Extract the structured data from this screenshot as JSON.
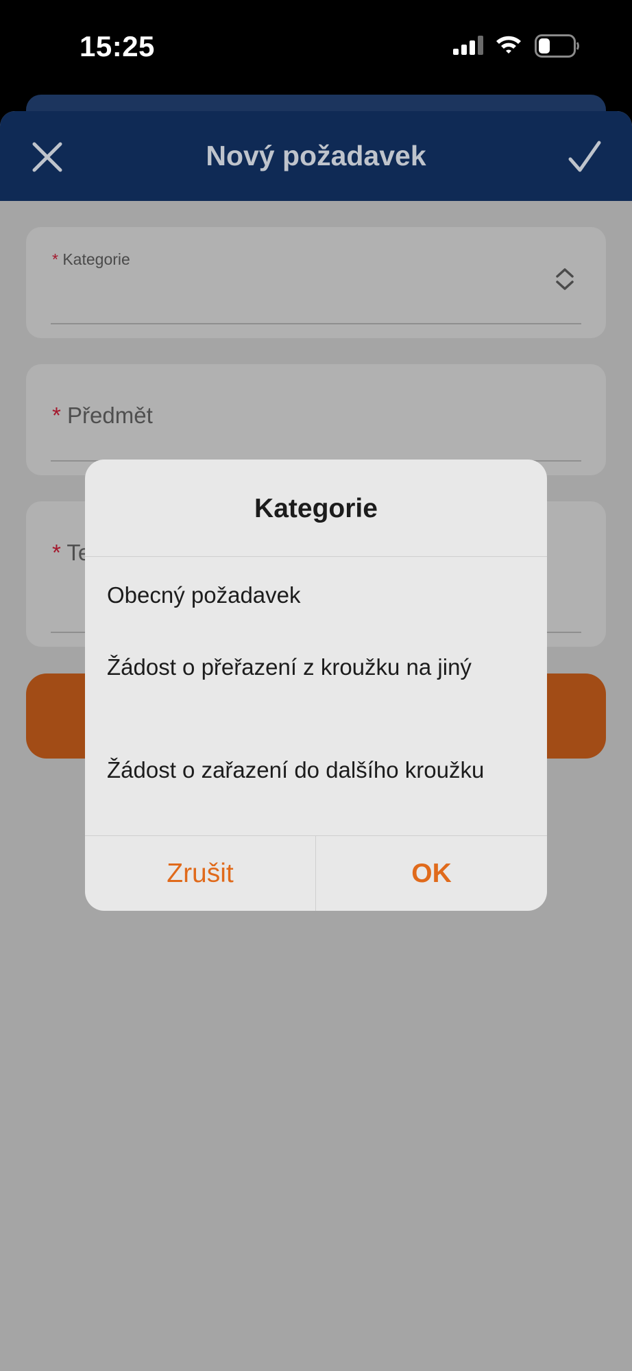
{
  "status_bar": {
    "time": "15:25"
  },
  "nav": {
    "title": "Nový požadavek"
  },
  "form": {
    "required_mark": "*",
    "category_label": "Kategorie",
    "subject_label": "Předmět",
    "text_label_partial": "Te"
  },
  "dialog": {
    "title": "Kategorie",
    "options": [
      "Obecný požadavek",
      "Žádost o přeřazení z kroužku na jiný",
      "Žádost o zařazení do dalšího kroužku"
    ],
    "cancel_label": "Zrušit",
    "ok_label": "OK"
  },
  "colors": {
    "nav_bg": "#0f2a55",
    "accent": "#e06a1b",
    "required": "#a4182d",
    "primary_button": "#a24c16"
  },
  "icons": [
    "close-icon",
    "check-icon",
    "chevron-up-down-icon",
    "signal-icon",
    "wifi-icon",
    "battery-icon"
  ]
}
